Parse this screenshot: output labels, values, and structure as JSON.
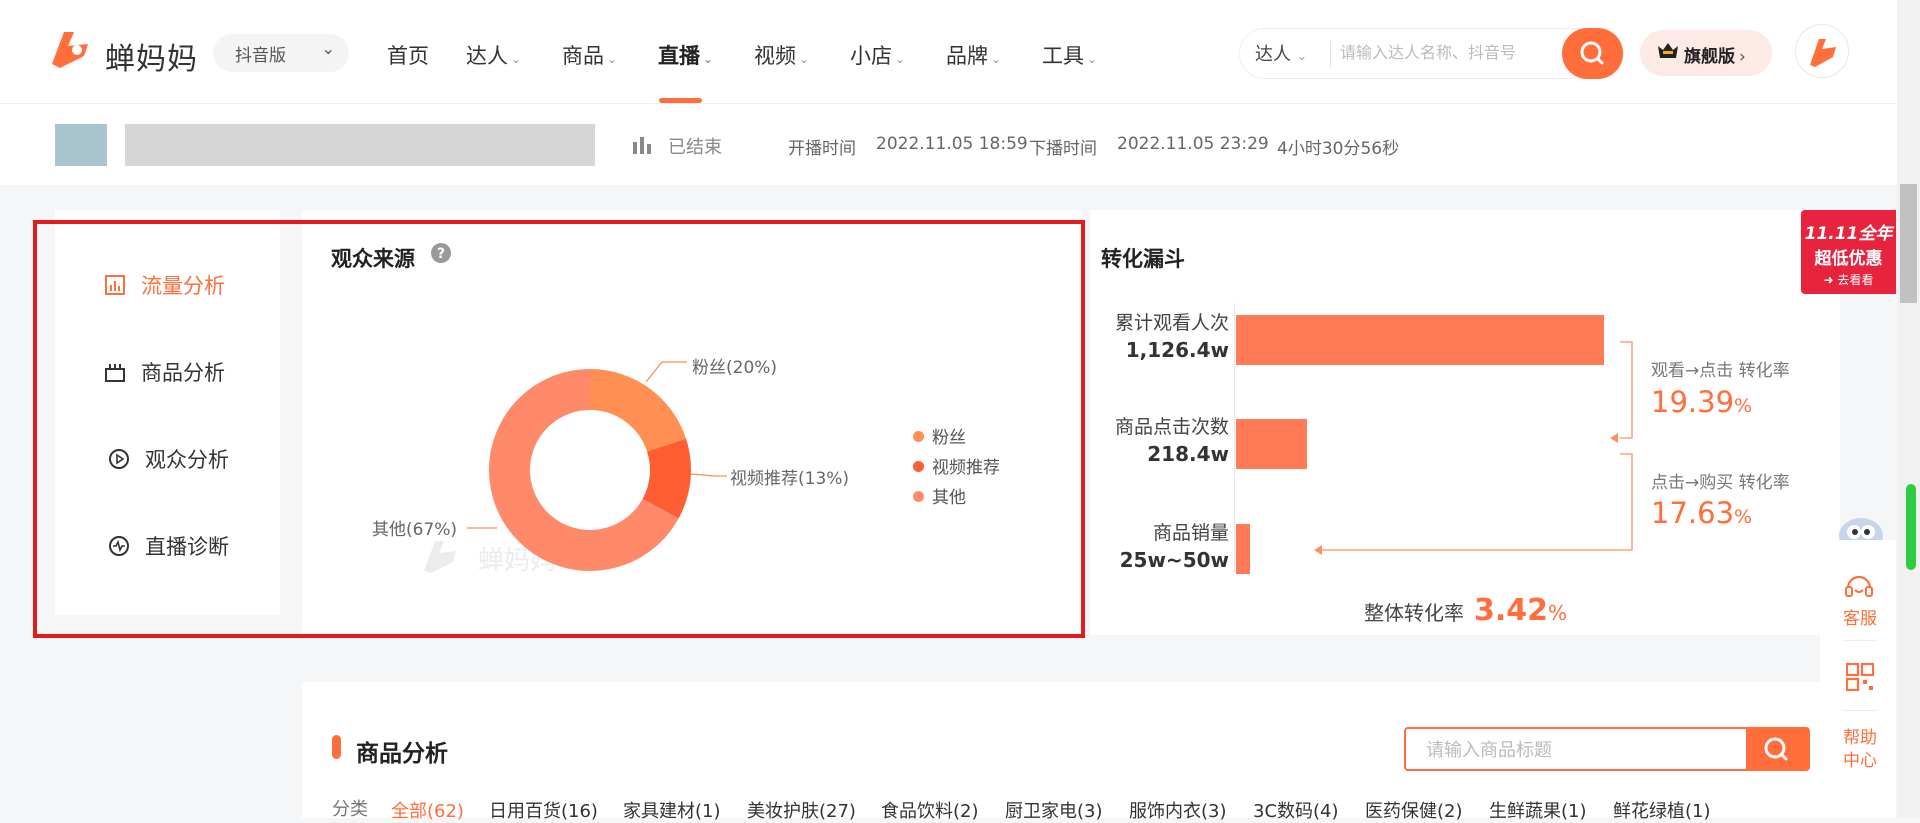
{
  "header": {
    "brand": "蝉妈妈",
    "version_label": "抖音版",
    "nav": [
      {
        "label": "首页",
        "has_menu": false
      },
      {
        "label": "达人",
        "has_menu": true
      },
      {
        "label": "商品",
        "has_menu": true
      },
      {
        "label": "直播",
        "has_menu": true,
        "active": true
      },
      {
        "label": "视频",
        "has_menu": true
      },
      {
        "label": "小店",
        "has_menu": true
      },
      {
        "label": "品牌",
        "has_menu": true
      },
      {
        "label": "工具",
        "has_menu": true
      }
    ],
    "search_type": "达人",
    "search_placeholder": "请输入达人名称、抖音号",
    "flagship_label": "旗舰版",
    "colors": {
      "accent": "#ff6e3b",
      "highlight_border": "#e21b1b",
      "promo": "#e8233e"
    }
  },
  "live_info": {
    "status": "已结束",
    "start_label": "开播时间",
    "start_time": "2022.11.05 18:59",
    "end_label": "下播时间",
    "end_time": "2022.11.05 23:29",
    "duration": "4小时30分56秒"
  },
  "side_nav": [
    {
      "label": "流量分析",
      "icon": "bar-chart-icon",
      "active": true
    },
    {
      "label": "商品分析",
      "icon": "goods-icon"
    },
    {
      "label": "观众分析",
      "icon": "play-circle-icon"
    },
    {
      "label": "直播诊断",
      "icon": "pulse-icon"
    }
  ],
  "audience_source": {
    "title": "观众来源",
    "watermark": "蝉妈妈",
    "callouts": {
      "fans": "粉丝(20%)",
      "video": "视频推荐(13%)",
      "other": "其他(67%)"
    },
    "legend": [
      "粉丝",
      "视频推荐",
      "其他"
    ]
  },
  "funnel": {
    "title": "转化漏斗",
    "rows": [
      {
        "label": "累计观看人次",
        "value": "1,126.4w"
      },
      {
        "label": "商品点击次数",
        "value": "218.4w"
      },
      {
        "label": "商品销量",
        "value": "25w~50w"
      }
    ],
    "rates": [
      {
        "label": "观看→点击 转化率",
        "value": "19.39",
        "unit": "%"
      },
      {
        "label": "点击→购买 转化率",
        "value": "17.63",
        "unit": "%"
      }
    ],
    "overall_label": "整体转化率",
    "overall_value": "3.42",
    "overall_unit": "%"
  },
  "chart_data": [
    {
      "type": "pie",
      "title": "观众来源",
      "categories": [
        "粉丝",
        "视频推荐",
        "其他"
      ],
      "values": [
        20,
        13,
        67
      ],
      "colors": [
        "#ff8f52",
        "#ff5e35",
        "#ff8a6a"
      ],
      "legend": "right"
    },
    {
      "type": "bar",
      "title": "转化漏斗",
      "categories": [
        "累计观看人次",
        "商品点击次数",
        "商品销量"
      ],
      "values": [
        1126.4,
        218.4,
        37.5
      ],
      "orientation": "horizontal"
    }
  ],
  "goods_analysis": {
    "title": "商品分析",
    "search_placeholder": "请输入商品标题",
    "category_label": "分类",
    "categories": [
      "全部(62)",
      "日用百货(16)",
      "家具建材(1)",
      "美妆护肤(27)",
      "食品饮料(2)",
      "厨卫家电(3)",
      "服饰内衣(3)",
      "3C数码(4)",
      "医药保健(2)",
      "生鲜蔬果(1)",
      "鲜花绿植(1)"
    ]
  },
  "float_sidebar": {
    "promo_line1": "11.11全年",
    "promo_line2": "超低优惠",
    "promo_cta": "去看看",
    "service_label": "客服",
    "help_label": "帮助中心"
  }
}
